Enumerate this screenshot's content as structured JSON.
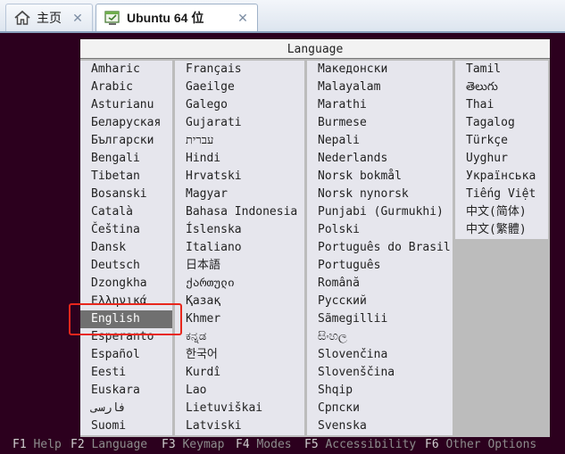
{
  "tabs": [
    {
      "label": "主页",
      "icon": "home-icon",
      "close": "✕"
    },
    {
      "label": "Ubuntu 64 位",
      "icon": "vm-icon",
      "close": "✕"
    }
  ],
  "dialog": {
    "title": "Language",
    "selected": "English",
    "columns": [
      [
        "Amharic",
        "Arabic",
        "Asturianu",
        "Беларуская",
        "Български",
        "Bengali",
        "Tibetan",
        "Bosanski",
        "Català",
        "Čeština",
        "Dansk",
        "Deutsch",
        "Dzongkha",
        "Ελληνικά",
        "English",
        "Esperanto",
        "Español",
        "Eesti",
        "Euskara",
        "فارسی",
        "Suomi"
      ],
      [
        "Français",
        "Gaeilge",
        "Galego",
        "Gujarati",
        "עברית",
        "Hindi",
        "Hrvatski",
        "Magyar",
        "Bahasa Indonesia",
        "Íslenska",
        "Italiano",
        "日本語",
        "ქართული",
        "Қазақ",
        "Khmer",
        "ಕನ್ನಡ",
        "한국어",
        "Kurdî",
        "Lao",
        "Lietuviškai",
        "Latviski"
      ],
      [
        "Македонски",
        "Malayalam",
        "Marathi",
        "Burmese",
        "Nepali",
        "Nederlands",
        "Norsk bokmål",
        "Norsk nynorsk",
        "Punjabi (Gurmukhi)",
        "Polski",
        "Português do Brasil",
        "Português",
        "Română",
        "Русский",
        "Sãmegillii",
        "සිංහල",
        "Slovenčina",
        "Slovenščina",
        "Shqip",
        "Српски",
        "Svenska"
      ],
      [
        "Tamil",
        "తెలుగు",
        "Thai",
        "Tagalog",
        "Türkçe",
        "Uyghur",
        "Українська",
        "Tiếng Việt",
        "中文(简体)",
        "中文(繁體)"
      ]
    ]
  },
  "fkeys": [
    {
      "key": "F1",
      "action": "Help"
    },
    {
      "key": "F2",
      "action": "Language"
    },
    {
      "key": "F3",
      "action": "Keymap"
    },
    {
      "key": "F4",
      "action": "Modes"
    },
    {
      "key": "F5",
      "action": "Accessibility"
    },
    {
      "key": "F6",
      "action": "Other Options"
    }
  ]
}
